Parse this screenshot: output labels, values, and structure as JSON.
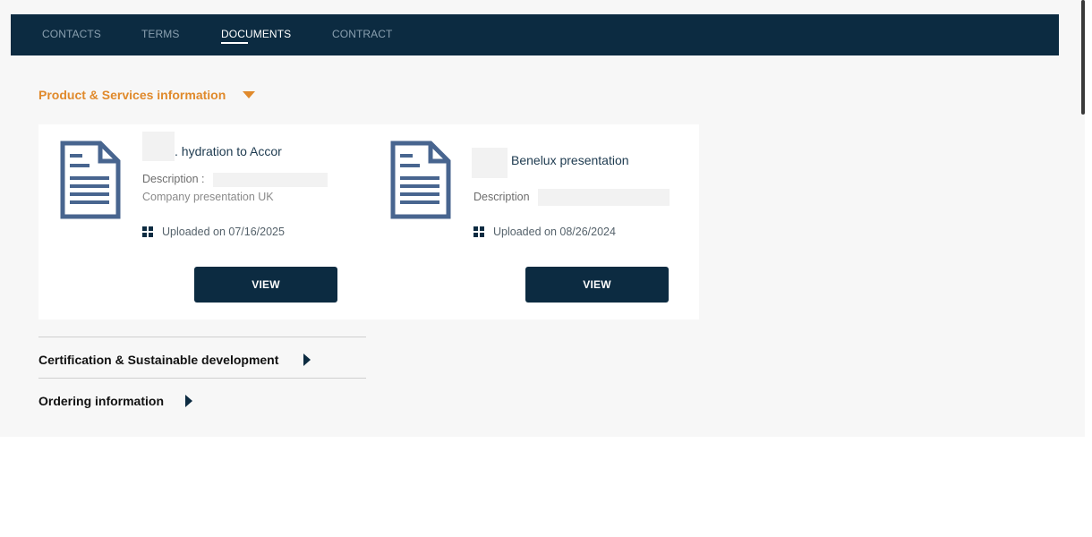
{
  "tabs": [
    {
      "label": "CONTACTS"
    },
    {
      "label": "TERMS"
    },
    {
      "label": "DOCUMENTS"
    },
    {
      "label": "CONTRACT"
    }
  ],
  "active_tab": "DOCUMENTS",
  "sections": {
    "product_services": {
      "title": "Product & Services information",
      "expanded": true
    },
    "certification": {
      "title": "Certification & Sustainable development",
      "expanded": false
    },
    "ordering": {
      "title": "Ordering information",
      "expanded": false
    }
  },
  "documents": [
    {
      "title": ". hydration to Accor",
      "description_label": "Description :",
      "description_value": "Company presentation UK",
      "uploaded": "Uploaded on 07/16/2025",
      "button": "VIEW"
    },
    {
      "title": "Benelux presentation",
      "description_label": "Description",
      "uploaded": "Uploaded on 08/26/2024",
      "button": "VIEW"
    }
  ],
  "colors": {
    "navy": "#0c2b41",
    "accent_orange": "#e08a2c",
    "doc_icon": "#48658f"
  }
}
